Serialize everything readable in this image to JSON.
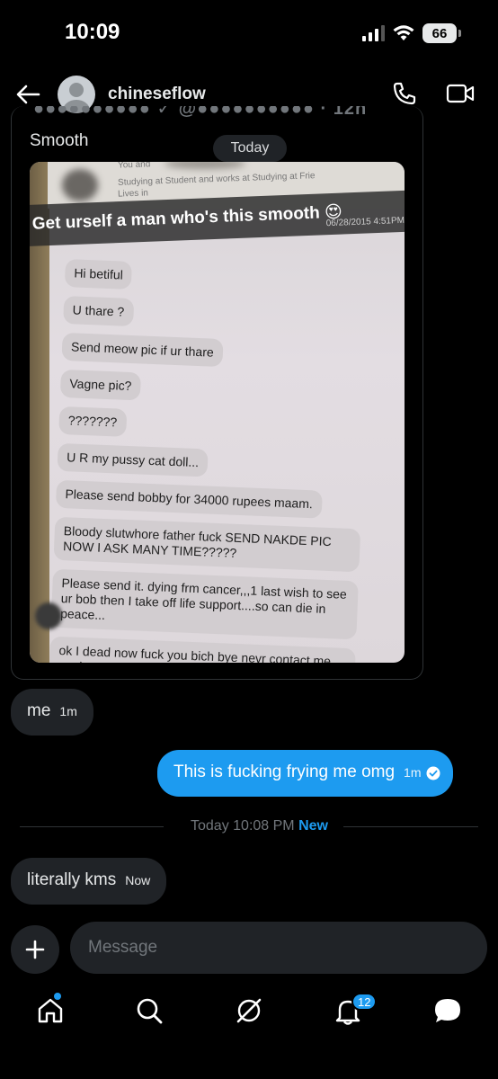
{
  "status_bar": {
    "time": "10:09",
    "battery": "66"
  },
  "header": {
    "contact_name": "chineseflow"
  },
  "quoted_post": {
    "text": "Smooth",
    "date_pill": "Today",
    "photo": {
      "profile_line_1": "You and",
      "profile_line_2": "Studying at Student and works at Studying at Frie",
      "profile_line_3": "Lives in",
      "caption": "Get urself a man who's this smooth 😍",
      "timestamp": "06/28/2015 4:51PM",
      "messages": [
        "Hi betiful",
        "U thare ?",
        "Send meow pic if ur thare",
        "Vagne pic?",
        "???????",
        "U R my pussy cat doll...",
        "Please send bobby for 34000 rupees maam.",
        "Bloody slutwhore father fuck SEND NAKDE PIC NOW I ASK MANY TIME?????",
        "Please send it. dying frm cancer,,,1 last wish to see ur bob then I take off life support....so can die in peace...",
        "ok I dead now fuck you bich bye nevr contact me again,,,,"
      ]
    }
  },
  "messages": [
    {
      "direction": "in",
      "text": "me",
      "time": "1m"
    },
    {
      "direction": "out",
      "text": "This is fucking frying me omg",
      "time": "1m"
    },
    {
      "direction": "in",
      "text": "literally kms",
      "time": "Now"
    }
  ],
  "divider": {
    "text": "Today 10:08 PM",
    "new_label": "New"
  },
  "composer": {
    "placeholder": "Message"
  },
  "nav": {
    "notifications_count": "12",
    "items": [
      "home-icon",
      "search-icon",
      "grok-icon",
      "notifications-icon",
      "messages-icon"
    ]
  },
  "colors": {
    "background": "#000000",
    "incoming_bubble": "#202327",
    "outgoing_bubble": "#1d9bf0",
    "accent": "#1d9bf0",
    "muted_text": "#71767b"
  }
}
